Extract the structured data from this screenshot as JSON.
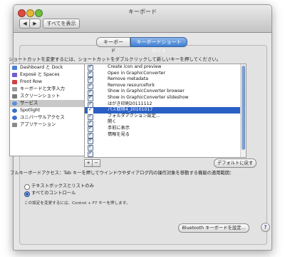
{
  "window": {
    "title": "キーボード",
    "nav_back": "◀",
    "nav_forward": "▶",
    "show_all": "すべてを表示"
  },
  "tabs": [
    {
      "label": "キーボード",
      "active": false
    },
    {
      "label": "キーボードショートカット",
      "active": true
    }
  ],
  "instruction": "ショートカットを変更するには、ショートカットをダブルクリックして新しいキーを押してください。",
  "categories": [
    {
      "label": "Dashboard と Dock",
      "icon": "dock-icon",
      "color": "#4a7fd4"
    },
    {
      "label": "Exposé と Spaces",
      "icon": "expose-icon",
      "color": "#6a5fd0"
    },
    {
      "label": "Front Row",
      "icon": "front-row-icon",
      "color": "#d04040"
    },
    {
      "label": "キーボードと文字入力",
      "icon": "keyboard-icon",
      "color": "#9a9a9a"
    },
    {
      "label": "スクリーンショット",
      "icon": "screenshot-icon",
      "color": "#7a7a7a"
    },
    {
      "label": "サービス",
      "icon": "services-icon",
      "color": "#5a8fd8",
      "selected": true
    },
    {
      "label": "Spotlight",
      "icon": "spotlight-icon",
      "color": "#3a70c8"
    },
    {
      "label": "ユニバーサルアクセス",
      "icon": "universal-access-icon",
      "color": "#3a6fd0"
    },
    {
      "label": "アプリケーション",
      "icon": "applications-icon",
      "color": "#8a8a8a"
    }
  ],
  "shortcuts": [
    {
      "label": "Create icon and preview"
    },
    {
      "label": "Open in GraphicConverter"
    },
    {
      "label": "Remove metadata"
    },
    {
      "label": "Remove resourcefork"
    },
    {
      "label": "Show in GraphicConverter browser"
    },
    {
      "label": "Show in GraphicConverter slideshow"
    },
    {
      "label": "はがき印刷20111112"
    },
    {
      "label": "パス取得4_20101017",
      "selected": true
    },
    {
      "label": "フォルダアクション設定..."
    },
    {
      "label": "開く"
    },
    {
      "label": "手前に表示"
    },
    {
      "label": "情報を見る"
    },
    {
      "label": ""
    },
    {
      "label": ""
    },
    {
      "label": ""
    }
  ],
  "buttons": {
    "add": "+",
    "remove": "−",
    "restore_defaults": "デフォルトに戻す",
    "bluetooth": "Bluetooth キーボードを設定...",
    "help": "?"
  },
  "full_keyboard_access": {
    "text": "フルキーボードアクセス：Tab キーを押してウインドウやダイアログ内の操作対象を移動する機能の適用範囲：",
    "options": [
      {
        "label": "テキストボックスとリストのみ",
        "selected": false
      },
      {
        "label": "すべてのコントロール",
        "selected": true
      }
    ],
    "note": "この設定を変更するには、Control + F7 キーを押します。"
  }
}
